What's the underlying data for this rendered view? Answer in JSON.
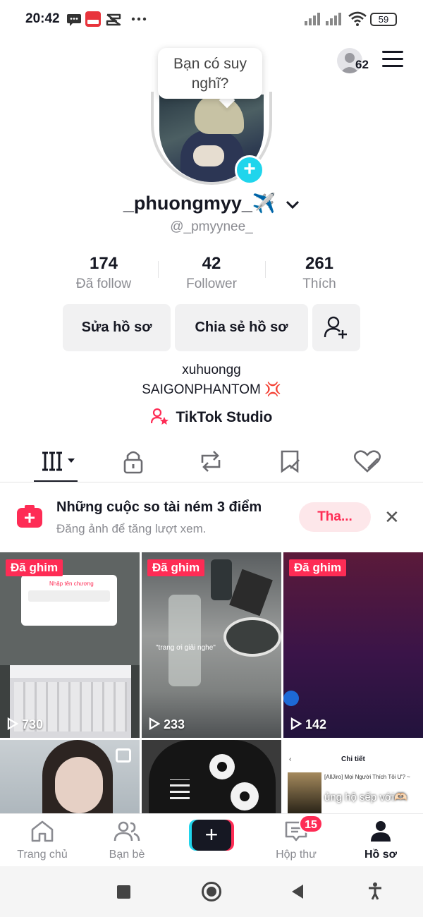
{
  "status_bar": {
    "time": "20:42",
    "battery": "59",
    "left_icons": [
      "message-icon",
      "mangatoon-app-icon",
      "capcut-icon",
      "more-dots-icon"
    ],
    "right_icons": [
      "signal-icon",
      "signal-icon",
      "wifi-icon",
      "battery-icon"
    ]
  },
  "header": {
    "note_bubble": "Bạn có suy nghĩ?",
    "viewers_count": "62",
    "menu_icon": "hamburger-menu-icon"
  },
  "profile": {
    "username": "_phuongmyy_✈️",
    "handle": "@_pmyynee_",
    "stats": [
      {
        "value": "174",
        "label": "Đã follow"
      },
      {
        "value": "42",
        "label": "Follower"
      },
      {
        "value": "261",
        "label": "Thích"
      }
    ],
    "buttons": {
      "edit": "Sửa hồ sơ",
      "share": "Chia sẻ hồ sơ"
    },
    "bio_line1": "xuhuongg",
    "bio_line2": "SAIGONPHANTOM 💢",
    "studio_link": "TikTok Studio"
  },
  "tabs": [
    {
      "icon": "videos-grid-icon",
      "active": true
    },
    {
      "icon": "lock-icon",
      "active": false
    },
    {
      "icon": "repost-icon",
      "active": false
    },
    {
      "icon": "bookmark-icon",
      "active": false
    },
    {
      "icon": "liked-heart-icon",
      "active": false
    }
  ],
  "promo": {
    "title": "Những cuộc so tài ném 3 điểm",
    "subtitle": "Đăng ảnh để tăng lượt xem.",
    "button": "Tha..."
  },
  "videos": [
    {
      "pinned": "Đã ghim",
      "views": "730",
      "overlay": "Nhập tên chương"
    },
    {
      "pinned": "Đã ghim",
      "views": "233",
      "overlay": "\"trang ơi giải nghe\""
    },
    {
      "pinned": "Đã ghim",
      "views": "142"
    },
    {
      "views": ""
    },
    {
      "views": ""
    },
    {
      "views": "",
      "overlay": "ủng hộ sếp với🫶🏻",
      "top_text": "Chi tiết",
      "item": "[AllJiro] Mọi Người Thích Tôi Ư? ~"
    }
  ],
  "bottom_nav": [
    {
      "label": "Trang chủ",
      "icon": "home-icon"
    },
    {
      "label": "Bạn bè",
      "icon": "friends-icon"
    },
    {
      "label": "",
      "icon": "create-plus-icon"
    },
    {
      "label": "Hộp thư",
      "icon": "inbox-icon",
      "badge": "15"
    },
    {
      "label": "Hồ sơ",
      "icon": "profile-icon",
      "active": true
    }
  ],
  "colors": {
    "accent": "#fe2c55",
    "cyan": "#20d5ec",
    "text": "#161823",
    "muted": "#8a8b91"
  }
}
